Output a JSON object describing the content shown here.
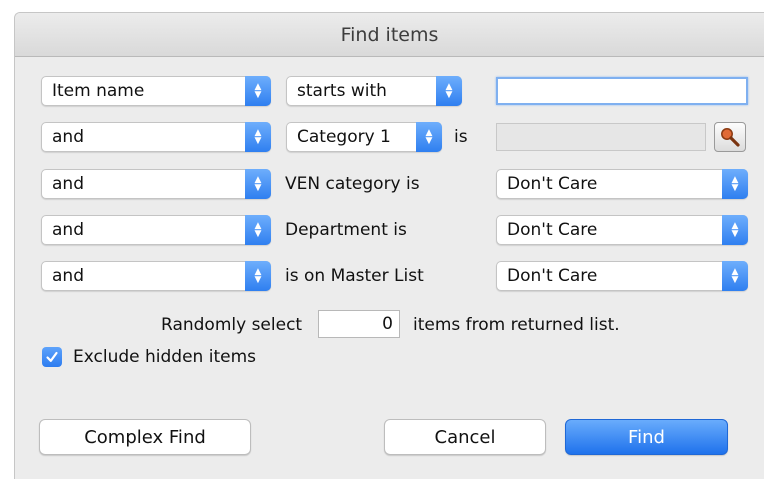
{
  "dialog": {
    "title": "Find items"
  },
  "rows": [
    {
      "field": "Item name",
      "operator": "starts with",
      "value": ""
    },
    {
      "conjunction": "and",
      "field": "Category 1",
      "suffix": "is",
      "value": ""
    },
    {
      "conjunction": "and",
      "label": "VEN category is",
      "value": "Don't Care"
    },
    {
      "conjunction": "and",
      "label": "Department is",
      "value": "Don't Care"
    },
    {
      "conjunction": "and",
      "label": "is on Master List",
      "value": "Don't Care"
    }
  ],
  "random": {
    "prefix": "Randomly select",
    "count": "0",
    "suffix": "items from returned list."
  },
  "exclude_hidden": {
    "label": "Exclude hidden items",
    "checked": true
  },
  "buttons": {
    "complex": "Complex Find",
    "cancel": "Cancel",
    "find": "Find"
  },
  "icons": {
    "stepper": "up-down-chevron-icon",
    "lookup": "magnifier-icon",
    "check": "checkmark-icon"
  },
  "colors": {
    "accent": "#2f7ff0",
    "background": "#ececec"
  }
}
